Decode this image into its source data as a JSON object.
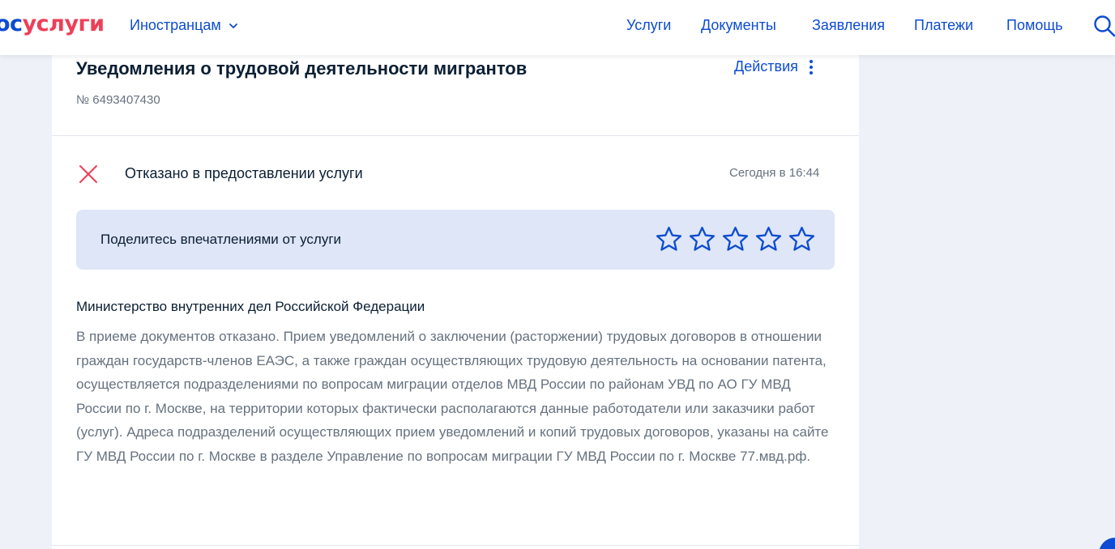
{
  "header": {
    "logo_part1": "ос",
    "logo_part2": "услуги",
    "language_menu": "Иностранцам",
    "nav": [
      "Услуги",
      "Документы",
      "Заявления",
      "Платежи",
      "Помощь"
    ]
  },
  "application": {
    "title": "Уведомления о трудовой деятельности мигрантов",
    "number": "№ 6493407430",
    "actions_label": "Действия"
  },
  "status": {
    "text": "Отказано в предоставлении услуги",
    "time": "Сегодня в 16:44",
    "icon": "close-icon",
    "color": "#ee3f58"
  },
  "feedback": {
    "prompt": "Поделитесь впечатлениями от услуги",
    "stars_total": 5,
    "rating": 0
  },
  "message": {
    "organization": "Министерство внутренних дел Российской Федерации",
    "text": "В приеме документов отказано. Прием уведомлений о заключении (расторжении) трудовых договоров в отношении граждан государств-членов ЕАЭС, а также граждан осуществляющих трудовую деятельность на основании патента, осуществляется подразделениями по вопросам миграции отделов МВД России по районам УВД по АО ГУ МВД России по г. Москве, на территории которых фактически располагаются данные работодатели или заказчики работ (услуг). Адреса подразделений осуществляющих прием уведомлений и копий трудовых договоров, указаны на сайте ГУ МВД России по г. Москве в разделе Управление по вопросам миграции ГУ МВД России по г. Москве 77.мвд.рф."
  },
  "colors": {
    "accent": "#0d4cd3",
    "brand_red": "#ee3f58",
    "background": "#eef2f8",
    "feedback_bg": "#dee6f7",
    "secondary_text": "#66727f"
  }
}
